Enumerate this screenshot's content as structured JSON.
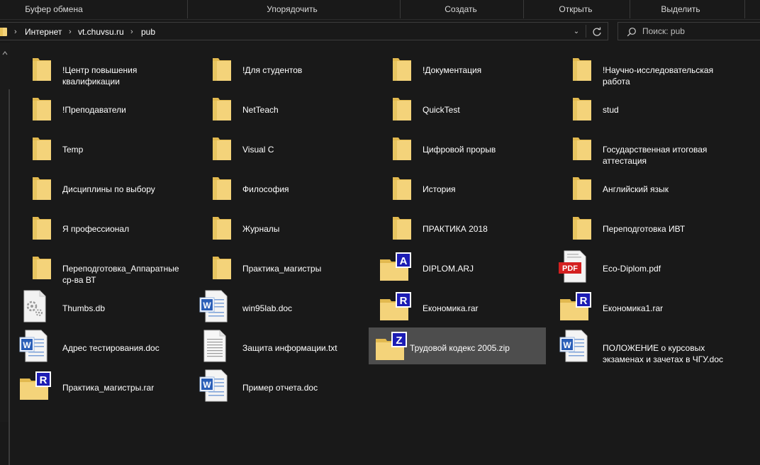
{
  "ribbon": {
    "groups": [
      "Буфер обмена",
      "Упорядочить",
      "Создать",
      "Открыть",
      "Выделить"
    ]
  },
  "address": {
    "crumbs": [
      "Интернет",
      "vt.chuvsu.ru",
      "pub"
    ]
  },
  "search": {
    "placeholder": "Поиск: pub"
  },
  "items": [
    {
      "name": "!Центр повышения квалификации",
      "type": "folder",
      "lines": [
        "!Центр повышения",
        "квалификации"
      ]
    },
    {
      "name": "!Для студентов",
      "type": "folder",
      "lines": [
        "!Для студентов"
      ]
    },
    {
      "name": "!Документация",
      "type": "folder",
      "lines": [
        "!Документация"
      ]
    },
    {
      "name": "!Научно-исследовательская работа",
      "type": "folder",
      "lines": [
        "!Научно-исследовательская",
        "работа"
      ]
    },
    {
      "name": "!Преподаватели",
      "type": "folder",
      "lines": [
        "!Преподаватели"
      ]
    },
    {
      "name": "NetTeach",
      "type": "folder",
      "lines": [
        "NetTeach"
      ]
    },
    {
      "name": "QuickTest",
      "type": "folder",
      "lines": [
        "QuickTest"
      ]
    },
    {
      "name": "stud",
      "type": "folder",
      "lines": [
        "stud"
      ]
    },
    {
      "name": "Temp",
      "type": "folder",
      "lines": [
        "Temp"
      ]
    },
    {
      "name": "Visual C",
      "type": "folder",
      "lines": [
        "Visual C"
      ]
    },
    {
      "name": "Цифровой прорыв",
      "type": "folder",
      "lines": [
        "Цифровой прорыв"
      ]
    },
    {
      "name": "Государственная итоговая аттестация",
      "type": "folder",
      "lines": [
        "Государственная итоговая",
        "аттестация"
      ]
    },
    {
      "name": "Дисциплины по выбору",
      "type": "folder",
      "lines": [
        "Дисциплины по выбору"
      ]
    },
    {
      "name": "Философия",
      "type": "folder",
      "lines": [
        "Философия"
      ]
    },
    {
      "name": "История",
      "type": "folder",
      "lines": [
        "История"
      ]
    },
    {
      "name": "Английский язык",
      "type": "folder",
      "lines": [
        "Английский язык"
      ]
    },
    {
      "name": "Я профессионал",
      "type": "folder",
      "lines": [
        "Я профессионал"
      ]
    },
    {
      "name": "Журналы",
      "type": "folder",
      "lines": [
        "Журналы"
      ]
    },
    {
      "name": "ПРАКТИКА 2018",
      "type": "folder",
      "lines": [
        "ПРАКТИКА 2018"
      ]
    },
    {
      "name": "Переподготовка ИВТ",
      "type": "folder",
      "lines": [
        "Переподготовка ИВТ"
      ]
    },
    {
      "name": "Переподготовка_Аппаратные ср-ва ВТ",
      "type": "folder",
      "lines": [
        "Переподготовка_Аппаратные",
        "ср-ва ВТ"
      ]
    },
    {
      "name": "Практика_магистры",
      "type": "folder",
      "lines": [
        "Практика_магистры"
      ]
    },
    {
      "name": "DIPLOM.ARJ",
      "type": "archive",
      "badge": "A",
      "lines": [
        "DIPLOM.ARJ"
      ]
    },
    {
      "name": "Eco-Diplom.pdf",
      "type": "pdf",
      "badge": "PDF",
      "lines": [
        "Eco-Diplom.pdf"
      ]
    },
    {
      "name": "Thumbs.db",
      "type": "db",
      "lines": [
        "Thumbs.db"
      ]
    },
    {
      "name": "win95lab.doc",
      "type": "doc",
      "badge": "W",
      "lines": [
        "win95lab.doc"
      ]
    },
    {
      "name": "Економика.rar",
      "type": "archive",
      "badge": "R",
      "lines": [
        "Економика.rar"
      ]
    },
    {
      "name": "Економика1.rar",
      "type": "archive",
      "badge": "R",
      "lines": [
        "Економика1.rar"
      ]
    },
    {
      "name": "Адрес тестирования.doc",
      "type": "doc",
      "badge": "W",
      "lines": [
        "Адрес тестирования.doc"
      ]
    },
    {
      "name": "Защита информации.txt",
      "type": "txt",
      "lines": [
        "Защита информации.txt"
      ]
    },
    {
      "name": "Трудовой кодекс 2005.zip",
      "type": "archive",
      "badge": "Z",
      "selected": true,
      "lines": [
        "Трудовой кодекс 2005.zip"
      ]
    },
    {
      "name": "ПОЛОЖЕНИЕ о курсовых экзаменах и зачетах в ЧГУ.doc",
      "type": "doc",
      "badge": "W",
      "lines": [
        "ПОЛОЖЕНИЕ о курсовых",
        "экзаменах и зачетах в ЧГУ.doc"
      ]
    },
    {
      "name": "Практика_магистры.rar",
      "type": "archive",
      "badge": "R",
      "lines": [
        "Практика_магистры.rar"
      ]
    },
    {
      "name": "Пример отчета.doc",
      "type": "doc",
      "badge": "W",
      "lines": [
        "Пример отчета.doc"
      ]
    }
  ],
  "colors": {
    "background": "#191919",
    "selection": "#4d4d4d",
    "folder": "#f4d37a",
    "archive_badge": "#1c1cb4",
    "pdf_badge": "#d42020",
    "word_badge": "#2b5fb8"
  }
}
